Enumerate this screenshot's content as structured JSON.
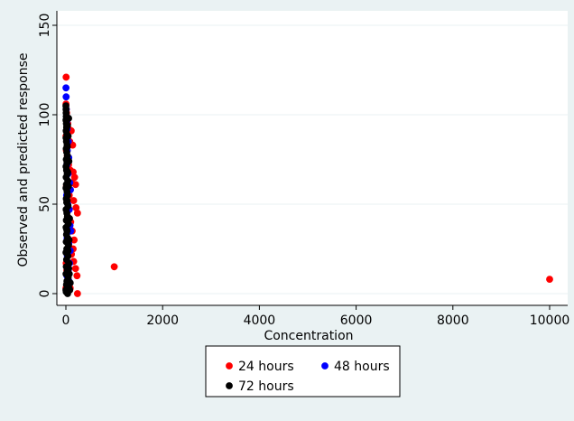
{
  "chart_data": {
    "type": "scatter",
    "xlabel": "Concentration",
    "ylabel": "Observed and predicted response",
    "xlim": [
      -100,
      10100
    ],
    "ylim": [
      -5,
      150
    ],
    "xticks": [
      0,
      2000,
      4000,
      6000,
      8000,
      10000
    ],
    "yticks": [
      0,
      50,
      100,
      150
    ],
    "grid": "horizontal",
    "legend_position": "bottom",
    "series": [
      {
        "name": "24 hours",
        "color": "#ff0000",
        "points": [
          [
            5,
            121
          ],
          [
            2,
            106
          ],
          [
            8,
            103
          ],
          [
            15,
            101
          ],
          [
            25,
            98
          ],
          [
            40,
            95
          ],
          [
            60,
            92
          ],
          [
            110,
            91
          ],
          [
            80,
            85
          ],
          [
            140,
            83
          ],
          [
            3,
            88
          ],
          [
            10,
            80
          ],
          [
            30,
            77
          ],
          [
            55,
            72
          ],
          [
            90,
            69
          ],
          [
            150,
            68
          ],
          [
            120,
            62
          ],
          [
            180,
            65
          ],
          [
            200,
            61
          ],
          [
            12,
            60
          ],
          [
            70,
            55
          ],
          [
            160,
            52
          ],
          [
            210,
            48
          ],
          [
            240,
            45
          ],
          [
            35,
            43
          ],
          [
            100,
            40
          ],
          [
            130,
            35
          ],
          [
            170,
            30
          ],
          [
            150,
            25
          ],
          [
            115,
            22
          ],
          [
            160,
            18
          ],
          [
            200,
            14
          ],
          [
            230,
            10
          ],
          [
            240,
            0
          ],
          [
            90,
            3
          ],
          [
            45,
            8
          ],
          [
            20,
            13
          ],
          [
            6,
            17
          ],
          [
            1,
            3
          ],
          [
            1000,
            15
          ],
          [
            10000,
            8
          ]
        ]
      },
      {
        "name": "48 hours",
        "color": "#0000ff",
        "points": [
          [
            2,
            115
          ],
          [
            5,
            110
          ],
          [
            8,
            103
          ],
          [
            12,
            99
          ],
          [
            18,
            96
          ],
          [
            25,
            92
          ],
          [
            35,
            88
          ],
          [
            50,
            85
          ],
          [
            30,
            80
          ],
          [
            60,
            76
          ],
          [
            20,
            72
          ],
          [
            45,
            67
          ],
          [
            80,
            62
          ],
          [
            95,
            58
          ],
          [
            15,
            55
          ],
          [
            40,
            50
          ],
          [
            70,
            47
          ],
          [
            55,
            42
          ],
          [
            85,
            38
          ],
          [
            100,
            35
          ],
          [
            25,
            31
          ],
          [
            60,
            28
          ],
          [
            90,
            24
          ],
          [
            30,
            21
          ],
          [
            75,
            17
          ],
          [
            50,
            13
          ],
          [
            20,
            10
          ],
          [
            65,
            7
          ],
          [
            35,
            4
          ],
          [
            10,
            2
          ]
        ]
      },
      {
        "name": "72 hours",
        "color": "#000000",
        "points": [
          [
            1,
            105
          ],
          [
            3,
            103
          ],
          [
            5,
            101
          ],
          [
            8,
            99
          ],
          [
            2,
            97
          ],
          [
            10,
            95
          ],
          [
            15,
            93
          ],
          [
            6,
            91
          ],
          [
            20,
            89
          ],
          [
            4,
            87
          ],
          [
            12,
            85
          ],
          [
            25,
            83
          ],
          [
            7,
            81
          ],
          [
            18,
            79
          ],
          [
            30,
            77
          ],
          [
            9,
            75
          ],
          [
            22,
            73
          ],
          [
            3,
            71
          ],
          [
            14,
            69
          ],
          [
            28,
            67
          ],
          [
            6,
            65
          ],
          [
            40,
            63
          ],
          [
            11,
            61
          ],
          [
            2,
            59
          ],
          [
            24,
            57
          ],
          [
            35,
            55
          ],
          [
            8,
            53
          ],
          [
            17,
            51
          ],
          [
            45,
            49
          ],
          [
            5,
            47
          ],
          [
            20,
            45
          ],
          [
            32,
            43
          ],
          [
            10,
            41
          ],
          [
            50,
            39
          ],
          [
            4,
            37
          ],
          [
            26,
            35
          ],
          [
            13,
            33
          ],
          [
            38,
            31
          ],
          [
            7,
            29
          ],
          [
            55,
            27
          ],
          [
            19,
            25
          ],
          [
            2,
            23
          ],
          [
            42,
            21
          ],
          [
            15,
            19
          ],
          [
            60,
            17
          ],
          [
            9,
            15
          ],
          [
            30,
            13
          ],
          [
            3,
            11
          ],
          [
            48,
            9
          ],
          [
            21,
            7
          ],
          [
            12,
            5
          ],
          [
            65,
            3
          ],
          [
            6,
            1
          ],
          [
            36,
            0
          ],
          [
            1,
            2
          ],
          [
            80,
            2
          ],
          [
            90,
            6
          ],
          [
            70,
            11
          ],
          [
            58,
            14
          ],
          [
            44,
            24
          ],
          [
            66,
            30
          ],
          [
            16,
            36
          ],
          [
            75,
            42
          ],
          [
            27,
            52
          ],
          [
            52,
            60
          ],
          [
            37,
            68
          ],
          [
            62,
            74
          ],
          [
            29,
            82
          ],
          [
            46,
            88
          ],
          [
            33,
            94
          ],
          [
            57,
            98
          ]
        ]
      }
    ]
  }
}
